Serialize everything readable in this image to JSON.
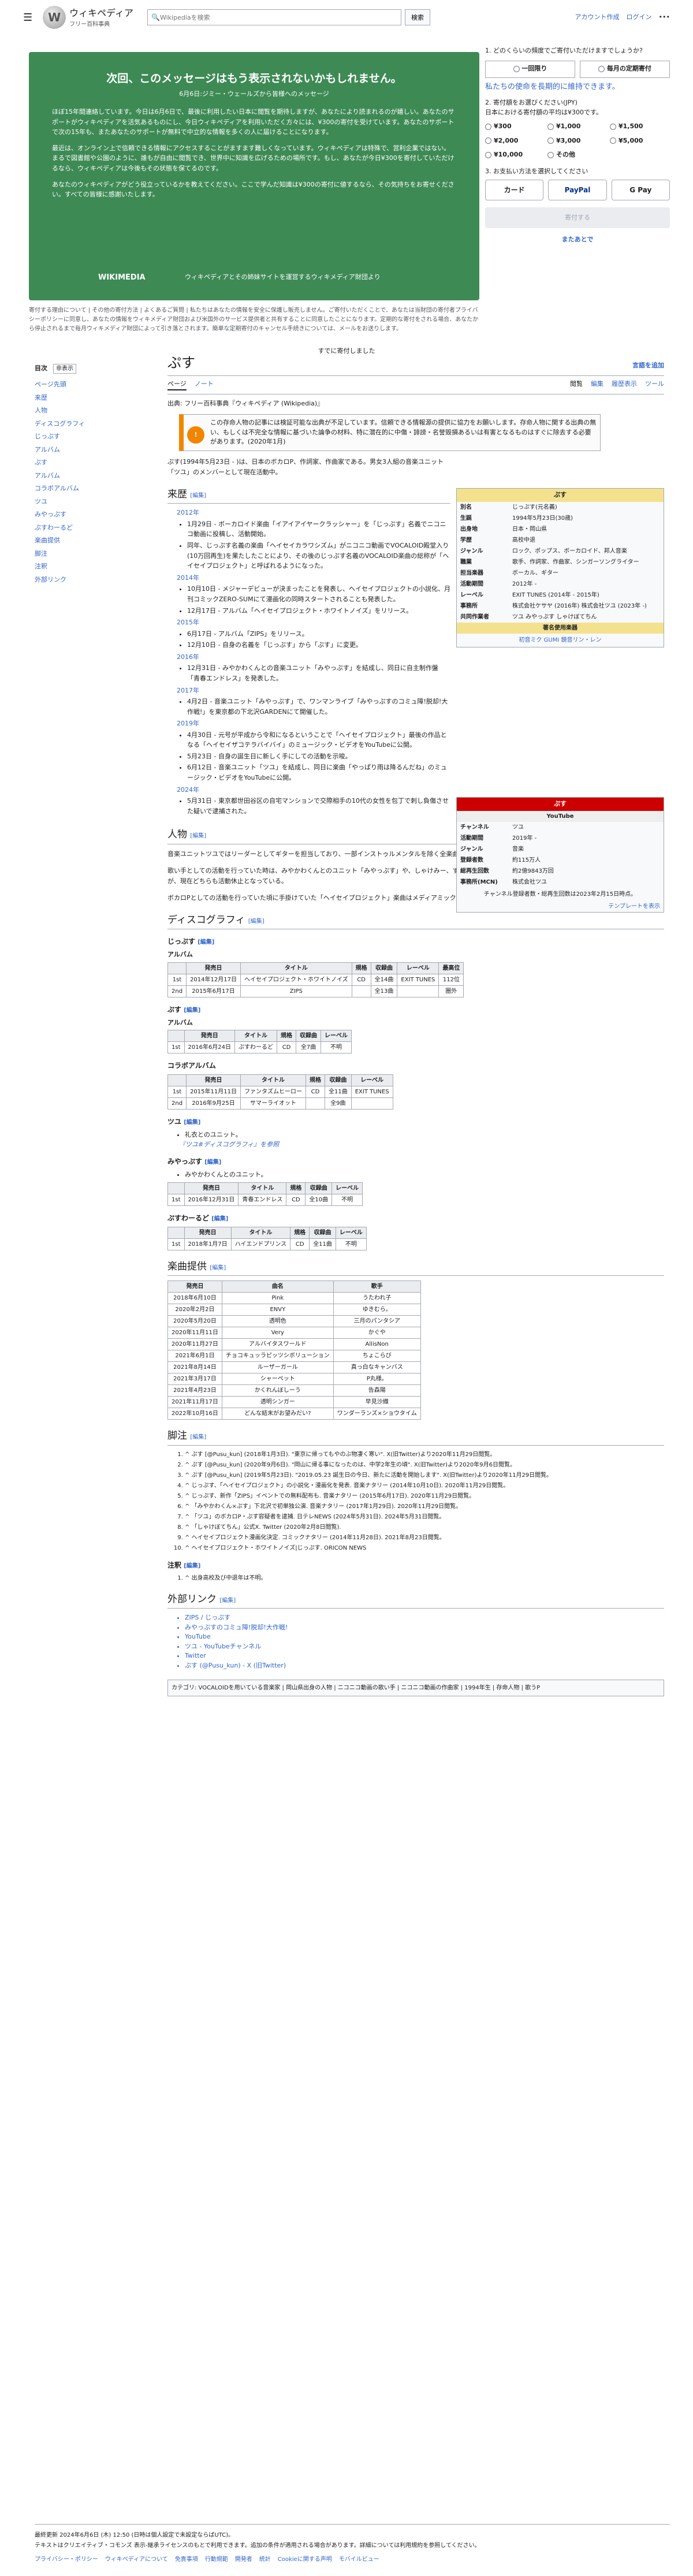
{
  "header": {
    "site": "ウィキペディア",
    "tagline": "フリー百科事典",
    "search_placeholder": "Wikipediaを検索",
    "search_btn": "検索",
    "account": "アカウント作成",
    "login": "ログイン",
    "more": "•••"
  },
  "banner": {
    "title": "次回、このメッセージはもう表示されないかもしれません。",
    "subtitle": "6月6日:ジミー・ウェールズから皆様へのメッセージ",
    "p1": "ほぼ15年間連絡しています。今日は6月6日で、最後に利用したい日本に閲覧を期待しますが、あなたにより読まれるのが嬉しい。あなたのサポートがウィキペディアを活気あるものにし、今日ウィキペディアを利用いただく方々には、¥300の寄付を受けています。あなたのサポートで次の15年も、またあなたのサポートが無料で中立的な情報を多くの人に届けることになります。",
    "p2": "最近は、オンライン上で信頼できる情報にアクセスすることがますます難しくなっています。ウィキペディアは特殊で、営利企業ではない。まるで図書館や公園のように、誰もが自由に閲覧でき、世界中に知識を広げるための場所です。もし、あなたが今日¥300を寄付していただけるなら、ウィキペディアは今後もその状態を保てるのです。",
    "p3": "あなたのウィキペディアがどう役立っているかを教えてください。ここで学んだ知識は¥300の寄付に値するなら、その気持ちをお寄せください。すべての皆様に感謝いたします。",
    "wmf": "WIKIMEDIA",
    "foot": "ウィキペディアとその姉妹サイトを運営するウィキメディア財団より"
  },
  "banner_note": "寄付する理由について | その他の寄付方法 | よくあるご質問 | 私たちはあなたの情報を安全に保護し販売しません。ご寄付いただくことで、あなたは当財団の寄付者プライバシーポリシーに同意し、あなたの情報をウィキメディア財団および米国外のサービス提供者と共有することに同意したことになります。定期的な寄付をされる場合、あなたから停止されるまで毎月ウィキメディア財団によって引き落とされます。簡単な定期寄付のキャンセル手続きについては、メールをお送りします。",
  "donate": {
    "q1": "1. どのくらいの頻度でご寄付いただけますでしょうか?",
    "once": "一回限り",
    "monthly": "毎月の定期寄付",
    "monthly_link": "私たちの使命を長期的に維持できます。",
    "q2": "2. 寄付額をお選びください(JPY)",
    "q2sub": "日本における寄付額の平均は¥300です。",
    "amounts": [
      "¥300",
      "¥1,000",
      "¥1,500",
      "¥2,000",
      "¥3,000",
      "¥5,000",
      "¥10,000",
      "その他"
    ],
    "q3": "3. お支払い方法を選択してください",
    "pay": [
      "カード",
      "PayPal",
      "G Pay"
    ],
    "donate_btn": "寄付する",
    "later": "またあとで"
  },
  "already": "すでに寄付しました",
  "toc": {
    "title": "目次",
    "hide": "非表示",
    "items": [
      {
        "label": "ページ先頭",
        "level": 1
      },
      {
        "label": "来歴",
        "level": 1
      },
      {
        "label": "人物",
        "level": 1
      },
      {
        "label": "ディスコグラフィ",
        "level": 1
      },
      {
        "label": "じっぷす",
        "level": 2
      },
      {
        "label": "アルバム",
        "level": 2
      },
      {
        "label": "ぷす",
        "level": 2
      },
      {
        "label": "アルバム",
        "level": 2
      },
      {
        "label": "コラボアルバム",
        "level": 2
      },
      {
        "label": "ツユ",
        "level": 2
      },
      {
        "label": "みやっぷす",
        "level": 2
      },
      {
        "label": "ぷすわーるど",
        "level": 2
      },
      {
        "label": "楽曲提供",
        "level": 1
      },
      {
        "label": "脚注",
        "level": 1
      },
      {
        "label": "注釈",
        "level": 2
      },
      {
        "label": "外部リンク",
        "level": 1
      }
    ]
  },
  "article": {
    "title": "ぷす",
    "lang": "言語を追加",
    "tabs_left": [
      "ページ",
      "ノート"
    ],
    "tabs_right": [
      "閲覧",
      "編集",
      "履歴表示",
      "ツール"
    ],
    "from": "出典: フリー百科事典『ウィキペディア (Wikipedia)』",
    "ambox": "この存命人物の記事には検証可能な出典が不足しています。信頼できる情報源の提供に協力をお願いします。存命人物に関する出典の無い、もしくは不完全な情報に基づいた論争の材料、特に潜在的に中傷・誹謗・名誉毀損あるいは有害となるものはすぐに除去する必要があります。(2020年1月)",
    "intro": "ぷす(1994年5月23日 - )は、日本のボカロP、作詞家、作曲家である。男女3人組の音楽ユニット「ツユ」のメンバーとして現在活動中。",
    "edit": "[編集]",
    "sections": {
      "history": "来歴",
      "person": "人物",
      "disco": "ディスコグラフィ",
      "supply": "楽曲提供",
      "notes": "脚注",
      "annot": "注釈",
      "ext": "外部リンク"
    }
  },
  "history": [
    {
      "year": "2012年",
      "items": [
        "1月29日 - ボーカロイド楽曲「イアイアイヤークラッシャー」を「じっぷす」名義でニコニコ動画に投稿し、活動開始。",
        "同年、じっぷす名義の楽曲「ヘイセイカラワシズム」がニコニコ動画でVOCALOID殿堂入り(10万回再生)を果たしたことにより、その後のじっぷす名義のVOCALOID楽曲の総称が「ヘイセイプロジェクト」と呼ばれるようになった。"
      ]
    },
    {
      "year": "2014年",
      "items": [
        "10月10日 - メジャーデビューが決まったことを発表し、ヘイセイプロジェクトの小説化、月刊コミックZERO-SUMにて漫画化の同時スタートされることも発表した。",
        "12月17日 - アルバム「ヘイセイプロジェクト・ホワイトノイズ」をリリース。"
      ]
    },
    {
      "year": "2015年",
      "items": [
        "6月17日 - アルバム「ZIPS」をリリース。",
        "12月10日 - 自身の名義を「じっぷす」から「ぷす」に変更。"
      ]
    },
    {
      "year": "2016年",
      "items": [
        "12月31日 - みやかわくんとの音楽ユニット「みやっぷす」を結成し、同日に自主制作盤「青春エンドレス」を発表した。"
      ]
    },
    {
      "year": "2017年",
      "items": [
        "4月2日 - 音楽ユニット「みやっぷす」で、ワンマンライブ「みやっぷすのコミュ障!脱却!大作戦!」を東京都の下北沢GARDENにて開催した。"
      ]
    },
    {
      "year": "2019年",
      "items": [
        "4月30日 - 元号が平成から令和になるということで「ヘイセイプロジェクト」最後の作品となる「ヘイセイザコテラバイバイ」のミュージック・ビデオをYouTubeに公開。",
        "5月23日 - 自身の誕生日に新しく手にしての活動を示唆。",
        "6月12日 - 音楽ユニット「ツユ」を結成し、同日に楽曲「やっぱり雨は降るんだね」のミュージック・ビデオをYouTubeに公開。"
      ]
    },
    {
      "year": "2024年",
      "items": [
        "5月31日 - 東京都世田谷区の自宅マンションで交際相手の10代の女性を包丁で刺し負傷させた疑いで逮捕された。"
      ]
    }
  ],
  "infobox": {
    "title": "ぷす",
    "rows": [
      [
        "別名",
        "じっぷす(元名義)"
      ],
      [
        "生誕",
        "1994年5月23日(30歳)"
      ],
      [
        "出身地",
        "日本・岡山県"
      ],
      [
        "学歴",
        "高校中退"
      ],
      [
        "ジャンル",
        "ロック、ポップス、ボーカロイド、邦人音楽"
      ],
      [
        "職業",
        "歌手、作詞家、作曲家、シンガーソングライター"
      ],
      [
        "担当楽器",
        "ボーカル、ギター"
      ],
      [
        "活動期間",
        "2012年 -"
      ],
      [
        "レーベル",
        "EXIT TUNES (2014年 - 2015年)"
      ],
      [
        "事務所",
        "株式会社ケサヤ (2016年) 株式会社ツユ (2023年 -)"
      ],
      [
        "共同作業者",
        "ツユ みやっぷす しゃけぼてちん"
      ]
    ],
    "notable": "著名使用楽器",
    "instruments": "初音ミク GUMI 鏡音リン・レン"
  },
  "infobox2": {
    "title": "ぷす",
    "sub": "YouTube",
    "rows": [
      [
        "チャンネル",
        "ツユ"
      ],
      [
        "活動期間",
        "2019年 -"
      ],
      [
        "ジャンル",
        "音楽"
      ],
      [
        "登録者数",
        "約115万人"
      ],
      [
        "総再生回数",
        "約2億9843万回"
      ],
      [
        "事務所(MCN)",
        "株式会社ツユ"
      ]
    ],
    "award": "チャンネル登録者数・総再生回数は2023年2月15日時点。",
    "template": "テンプレートを表示"
  },
  "person": {
    "p1": "音楽ユニットツユではリーダーとしてギターを担当しており、一部インストゥルメンタルを除く全楽曲の作詞作曲を行っている。",
    "p2": "歌い手としての活動を行っていた時は、みやかわくんとのユニット「みやっぷす」や、しゃけみー、ずたんばんとのユニット「しゃけぼてちん」としての活動も行っていたが、現在どちらも活動休止となっている。",
    "p3": "ボカロPとしての活動を行っていた頃に手掛けていた「ヘイセイプロジェクト」楽曲はメディアミックス展開され、2014年にマンガ・小説化された。"
  },
  "disco": {
    "jip": {
      "title": "じっぷす",
      "album": "アルバム",
      "headers": [
        "発売日",
        "タイトル",
        "規格",
        "収録曲",
        "レーベル",
        "最高位"
      ],
      "rows": [
        [
          "1st",
          "2014年12月17日",
          "ヘイセイプロジェクト・ホワイトノイズ",
          "CD",
          "全14曲",
          "EXIT TUNES",
          "112位"
        ],
        [
          "2nd",
          "2015年6月17日",
          "ZIPS",
          "",
          "全13曲",
          "",
          "圏外"
        ]
      ]
    },
    "pus": {
      "title": "ぷす",
      "album": "アルバム",
      "headers": [
        "発売日",
        "タイトル",
        "規格",
        "収録曲",
        "レーベル"
      ],
      "rows": [
        [
          "1st",
          "2016年6月24日",
          "ぷすわーるど",
          "CD",
          "全7曲",
          "不明"
        ]
      ]
    },
    "collab": {
      "title": "コラボアルバム",
      "headers": [
        "発売日",
        "タイトル",
        "規格",
        "収録曲",
        "レーベル"
      ],
      "rows": [
        [
          "1st",
          "2015年11月11日",
          "ファンタズムヒーロー",
          "CD",
          "全11曲",
          "EXIT TUNES"
        ],
        [
          "2nd",
          "2016年9月25日",
          "サマーライオット",
          "",
          "全9曲",
          ""
        ]
      ]
    },
    "tsuyu": {
      "title": "ツユ",
      "li": "礼衣とのユニット。",
      "see": "『ツユ#ディスコグラフィ』を参照"
    },
    "miya": {
      "title": "みやっぷす",
      "li": "みやかわくんとのユニット。",
      "headers": [
        "発売日",
        "タイトル",
        "規格",
        "収録曲",
        "レーベル"
      ],
      "rows": [
        [
          "1st",
          "2016年12月31日",
          "青春エンドレス",
          "CD",
          "全10曲",
          "不明"
        ]
      ]
    },
    "world": {
      "title": "ぷすわーるど",
      "headers": [
        "発売日",
        "タイトル",
        "規格",
        "収録曲",
        "レーベル"
      ],
      "rows": [
        [
          "1st",
          "2018年1月7日",
          "ハイエンドプリンス",
          "CD",
          "全11曲",
          "不明"
        ]
      ]
    }
  },
  "supply": {
    "headers": [
      "発売日",
      "曲名",
      "歌手"
    ],
    "rows": [
      [
        "2018年6月10日",
        "Pink",
        "うたわれ子"
      ],
      [
        "2020年2月2日",
        "ENVY",
        "ゆきむら。"
      ],
      [
        "2020年5月20日",
        "透明色",
        "三月のパンタシア"
      ],
      [
        "2020年11月11日",
        "Very",
        "かぐや"
      ],
      [
        "2020年11月27日",
        "アルバイタスワールド",
        "AllisNon"
      ],
      [
        "2021年6月1日",
        "チョコキュッラピッツシボリューション",
        "ちょこらび"
      ],
      [
        "2021年8月14日",
        "ルーザーガール",
        "真っ白なキャンバス"
      ],
      [
        "2021年3月17日",
        "シャーペット",
        "P丸様。"
      ],
      [
        "2021年4月23日",
        "かくれんぼしーう",
        "告森陽"
      ],
      [
        "2021年11月17日",
        "透明シンガー",
        "早見沙織"
      ],
      [
        "2022年10月16日",
        "どんな結末がお望みだい?",
        "ワンダーランズ×ショウタイム"
      ]
    ]
  },
  "refs": [
    "^ ぷす [@Pusu_kun] (2018年1月3日). \"東京に帰ってもやのぶ物凄く寒い\". X(旧Twitter)より2020年11月29日閲覧。",
    "^ ぷす [@Pusu_kun] (2020年9月6日). \"岡山に帰る事になったのは、中学2年生の頃\". X(旧Twitter)より2020年9月6日閲覧。",
    "^ ぷす [@Pusu_kun] (2019年5月23日). \"2019.05.23 誕生日の今日、新たに活動を開始します\". X(旧Twitter)より2020年11月29日閲覧。",
    "^ じっぷす、「ヘイセイプロジェクト」の小説化・漫画化を発表. 音楽ナタリー (2014年10月10日). 2020年11月29日閲覧。",
    "^ じっぷす、新作「ZIPS」イベントでの無料配布も. 音楽ナタリー (2015年6月17日). 2020年11月29日閲覧。",
    "^ 「みやかわくん×ぷす」下北沢で初単独公演. 音楽ナタリー (2017年1月29日). 2020年11月29日閲覧。",
    "^ 「ツユ」のボカロP・ぷす容疑者を逮捕. 日テレNEWS (2024年5月31日). 2024年5月31日閲覧。",
    "^ 「しゃけぼてちん」公式X. Twitter (2020年2月8日閲覧).",
    "^ ヘイセイプロジェクト漫画化決定. コミックナタリー (2014年11月28日). 2021年8月23日閲覧。",
    "^ ヘイセイプロジェクト・ホワイトノイズ|じっぷす. ORICON NEWS"
  ],
  "annot": [
    "^ 出身高校及び中退年は不明。"
  ],
  "ext": [
    "ZIPS / じっぷす",
    "みやっぷすのコミュ障!脱却!大作戦!",
    "YouTube",
    "ツユ - YouTubeチャンネル",
    "Twitter",
    "ぷす (@Pusu_kun) - X (旧Twitter)"
  ],
  "cats": "カテゴリ: VOCALOIDを用いている音楽家 | 岡山県出身の人物 | ニコニコ動画の歌い手 | ニコニコ動画の作曲家 | 1994年生 | 存命人物 | 歌うP",
  "footer": {
    "l1": "最終更新 2024年6月6日 (木) 12:50 (日時は個人設定で未設定ならばUTC)。",
    "l2": "テキストはクリエイティブ・コモンズ 表示-継承ライセンスのもとで利用できます。追加の条件が適用される場合があります。詳細については利用規約を参照してください。",
    "links": [
      "プライバシー・ポリシー",
      "ウィキペディアについて",
      "免責事項",
      "行動規範",
      "開発者",
      "統計",
      "Cookieに関する声明",
      "モバイルビュー"
    ]
  }
}
